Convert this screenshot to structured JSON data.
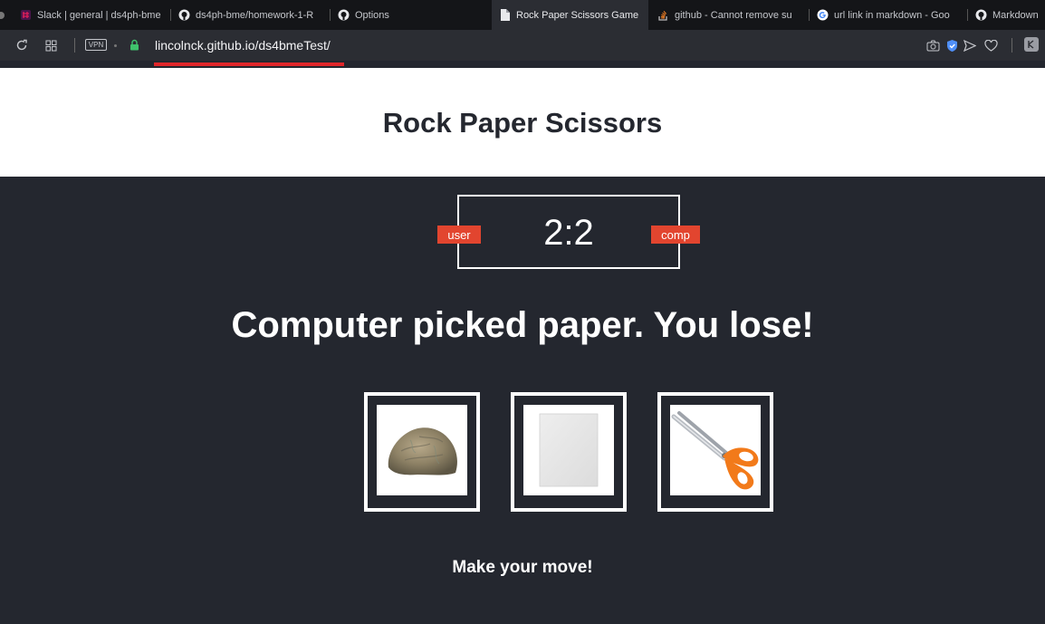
{
  "browser": {
    "tabs": [
      {
        "label": "Slack | general | ds4ph-bme",
        "icon": "slack-icon"
      },
      {
        "label": "ds4ph-bme/homework-1-R",
        "icon": "github-icon"
      },
      {
        "label": "Options",
        "icon": "github-icon"
      },
      {
        "label": "Rock Paper Scissors Game",
        "icon": "document-icon"
      },
      {
        "label": "github - Cannot remove su",
        "icon": "stackoverflow-icon"
      },
      {
        "label": "url link in markdown - Goo",
        "icon": "google-icon"
      },
      {
        "label": "Markdown",
        "icon": "github-icon"
      }
    ],
    "active_tab": 3,
    "vpn_label": "VPN",
    "url": "lincolnck.github.io/ds4bmeTest/"
  },
  "page": {
    "title": "Rock Paper Scissors",
    "score": "2:2",
    "user_label": "user",
    "comp_label": "comp",
    "result": "Computer picked paper. You lose!",
    "choices": [
      {
        "name": "rock",
        "icon": "rock-image"
      },
      {
        "name": "paper",
        "icon": "paper-image"
      },
      {
        "name": "scissors",
        "icon": "scissors-image"
      }
    ],
    "prompt": "Make your move!"
  },
  "colors": {
    "background": "#24272f",
    "header_bg": "#ffffff",
    "badge": "#e2452f",
    "progress": "#e0262a"
  }
}
